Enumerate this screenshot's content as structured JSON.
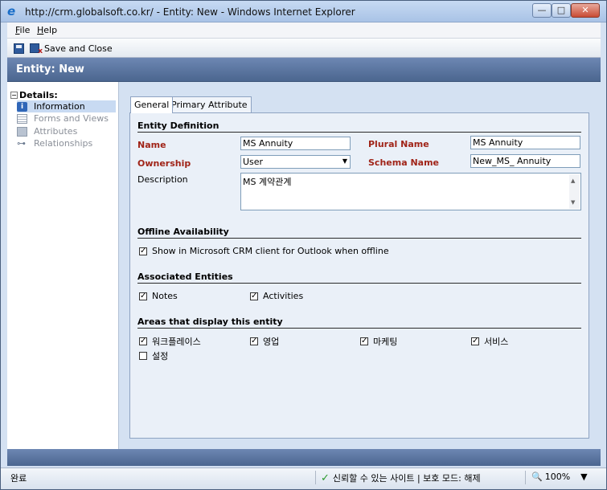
{
  "window": {
    "title": "http://crm.globalsoft.co.kr/ - Entity: New - Windows Internet Explorer",
    "min": "—",
    "max": "□",
    "close": "✕"
  },
  "menu": {
    "file_first": "F",
    "file_rest": "ile",
    "help_first": "H",
    "help_rest": "elp"
  },
  "toolbar": {
    "save_close_label": "Save and Close"
  },
  "header": {
    "title": "Entity: New"
  },
  "nav": {
    "section": "Details:",
    "items": [
      {
        "label": "Information",
        "icon": "info-icon",
        "selected": true
      },
      {
        "label": "Forms and Views",
        "icon": "form-icon"
      },
      {
        "label": "Attributes",
        "icon": "attributes-icon"
      },
      {
        "label": "Relationships",
        "icon": "relationships-icon"
      }
    ]
  },
  "tabs": [
    {
      "label": "General",
      "active": true
    },
    {
      "label": "Primary Attribute"
    }
  ],
  "entity_definition": {
    "title": "Entity Definition",
    "name_label": "Name",
    "name_value": "MS Annuity",
    "plural_label": "Plural Name",
    "plural_value": "MS Annuity",
    "ownership_label": "Ownership",
    "ownership_value": "User",
    "schema_label": "Schema Name",
    "schema_value": "New_MS_ Annuity",
    "description_label": "Description",
    "description_value": "MS 계약관계"
  },
  "offline": {
    "title": "Offline Availability",
    "option_label": "Show in Microsoft CRM client for Outlook when offline",
    "checked": true
  },
  "associated": {
    "title": "Associated Entities",
    "notes_label": "Notes",
    "notes_checked": true,
    "activities_label": "Activities",
    "activities_checked": true
  },
  "areas": {
    "title": "Areas that display this entity",
    "items": [
      {
        "label": "워크플레이스",
        "checked": true
      },
      {
        "label": "영업",
        "checked": true
      },
      {
        "label": "마케팅",
        "checked": true
      },
      {
        "label": "서비스",
        "checked": true
      },
      {
        "label": "설정",
        "checked": false
      }
    ]
  },
  "status": {
    "done": "완료",
    "trust": "신뢰할 수 있는 사이트 | 보호 모드: 해제",
    "zoom": "100%"
  },
  "check_mark": "✓"
}
